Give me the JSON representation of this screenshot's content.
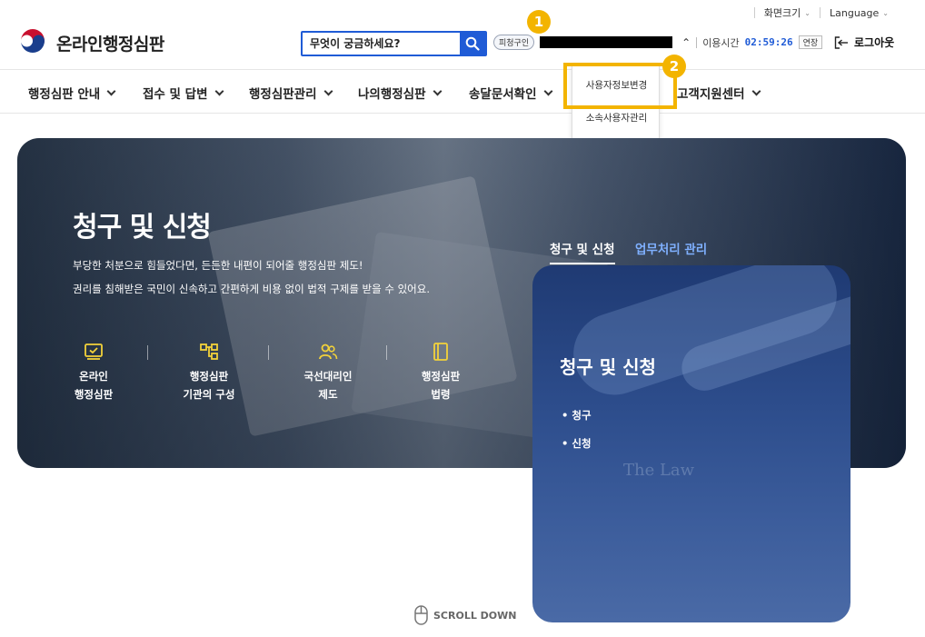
{
  "util": {
    "screen_size": "화면크기",
    "language": "Language"
  },
  "header": {
    "logo_text": "온라인행정심판",
    "search_placeholder": "무엇이 궁금하세요?",
    "user_badge": "피청구인",
    "usage_time_label": "이용시간",
    "usage_time": "02:59:26",
    "extend_label": "연장",
    "logout_label": "로그아웃"
  },
  "markers": {
    "first": "1",
    "second": "2"
  },
  "nav": {
    "items": [
      {
        "label": "행정심판 안내"
      },
      {
        "label": "접수 및 답변"
      },
      {
        "label": "행정심판관리"
      },
      {
        "label": "나의행정심판"
      },
      {
        "label": "송달문서확인"
      },
      {
        "label": "고객지원센터"
      }
    ]
  },
  "dropdown": {
    "items": [
      {
        "label": "사용자정보변경"
      },
      {
        "label": "소속사용자관리"
      }
    ]
  },
  "hero": {
    "title": "청구 및 신청",
    "desc1": "부당한 처분으로 힘들었다면, 든든한 내편이 되어줄 행정심판 제도!",
    "desc2": "권리를 침해받은 국민이 신속하고 간편하게 비용 없이 법적 구제를 받을 수 있어요.",
    "quick_links": [
      {
        "line1": "온라인",
        "line2": "행정심판"
      },
      {
        "line1": "행정심판",
        "line2": "기관의 구성"
      },
      {
        "line1": "국선대리인",
        "line2": "제도"
      },
      {
        "line1": "행정심판",
        "line2": "법령"
      }
    ]
  },
  "tabs": [
    {
      "label": "청구 및 신청"
    },
    {
      "label": "업무처리 관리"
    }
  ],
  "card": {
    "title": "청구 및 신청",
    "links": [
      "청구",
      "신청"
    ],
    "watermark": "The Law"
  },
  "scroll_label": "SCROLL DOWN",
  "colors": {
    "accent_blue": "#1f5bd6",
    "marker_yellow": "#f3b400",
    "card_blue": "#2d4d8c"
  }
}
